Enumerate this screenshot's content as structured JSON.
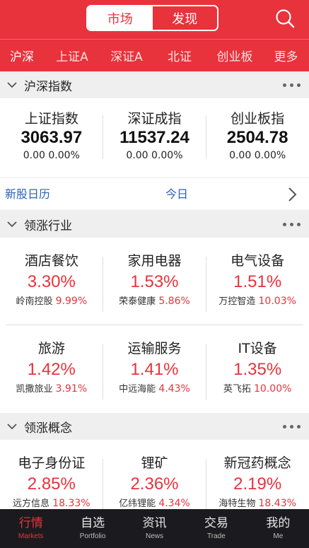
{
  "header": {
    "seg_market": "市场",
    "seg_discover": "发现",
    "search_icon": "search-icon"
  },
  "tabs": [
    "沪深",
    "上证A",
    "深证A",
    "北证",
    "创业板",
    "更多"
  ],
  "indices_section": {
    "title": "沪深指数",
    "items": [
      {
        "name": "上证指数",
        "value": "3063.97",
        "change": "0.00 0.00%"
      },
      {
        "name": "深证成指",
        "value": "11537.24",
        "change": "0.00 0.00%"
      },
      {
        "name": "创业板指",
        "value": "2504.78",
        "change": "0.00 0.00%"
      }
    ]
  },
  "ipo": {
    "label": "新股日历",
    "today": "今日"
  },
  "industry_section": {
    "title": "领涨行业",
    "rows": [
      [
        {
          "name": "酒店餐饮",
          "pct": "3.30%",
          "stock": "岭南控股",
          "stock_pct": "9.99%"
        },
        {
          "name": "家用电器",
          "pct": "1.53%",
          "stock": "荣泰健康",
          "stock_pct": "5.86%"
        },
        {
          "name": "电气设备",
          "pct": "1.51%",
          "stock": "万控智造",
          "stock_pct": "10.03%"
        }
      ],
      [
        {
          "name": "旅游",
          "pct": "1.42%",
          "stock": "凯撒旅业",
          "stock_pct": "3.91%"
        },
        {
          "name": "运输服务",
          "pct": "1.41%",
          "stock": "中远海能",
          "stock_pct": "4.43%"
        },
        {
          "name": "IT设备",
          "pct": "1.35%",
          "stock": "英飞拓",
          "stock_pct": "10.00%"
        }
      ]
    ]
  },
  "concept_section": {
    "title": "领涨概念",
    "items": [
      {
        "name": "电子身份证",
        "pct": "2.85%",
        "stock": "远方信息",
        "stock_pct": "18.33%"
      },
      {
        "name": "锂矿",
        "pct": "2.36%",
        "stock": "亿纬锂能",
        "stock_pct": "4.34%"
      },
      {
        "name": "新冠药概念",
        "pct": "2.19%",
        "stock": "海特生物",
        "stock_pct": "18.43%"
      }
    ]
  },
  "bottom_nav": [
    {
      "zh": "行情",
      "en": "Markets"
    },
    {
      "zh": "自选",
      "en": "Portfolio"
    },
    {
      "zh": "资讯",
      "en": "News"
    },
    {
      "zh": "交易",
      "en": "Trade"
    },
    {
      "zh": "我的",
      "en": "Me"
    }
  ],
  "colors": {
    "brand_red": "#e8323c",
    "link_blue": "#2a62b8",
    "nav_bg": "#1b1b1f"
  }
}
